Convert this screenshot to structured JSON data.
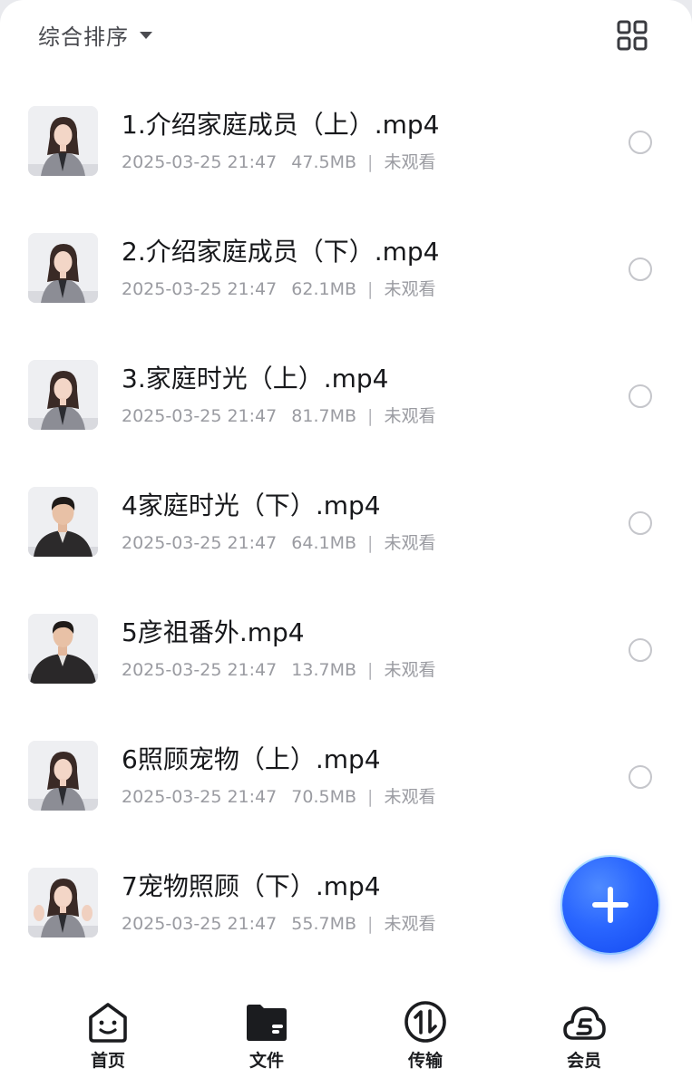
{
  "header": {
    "sort_label": "综合排序",
    "sort_icon": "caret-down-icon",
    "view_toggle_icon": "grid-view-icon"
  },
  "files": [
    {
      "name": "1.介绍家庭成员（上）.mp4",
      "date": "2025-03-25 21:47",
      "size": "47.5MB",
      "status": "未观看",
      "thumb": "woman-presenter"
    },
    {
      "name": "2.介绍家庭成员（下）.mp4",
      "date": "2025-03-25 21:47",
      "size": "62.1MB",
      "status": "未观看",
      "thumb": "woman-presenter"
    },
    {
      "name": "3.家庭时光（上）.mp4",
      "date": "2025-03-25 21:47",
      "size": "81.7MB",
      "status": "未观看",
      "thumb": "woman-presenter"
    },
    {
      "name": "4家庭时光（下）.mp4",
      "date": "2025-03-25 21:47",
      "size": "64.1MB",
      "status": "未观看",
      "thumb": "man-presenter"
    },
    {
      "name": "5彦祖番外.mp4",
      "date": "2025-03-25 21:47",
      "size": "13.7MB",
      "status": "未观看",
      "thumb": "man-presenter"
    },
    {
      "name": "6照顾宠物（上）.mp4",
      "date": "2025-03-25 21:47",
      "size": "70.5MB",
      "status": "未观看",
      "thumb": "woman-presenter"
    },
    {
      "name": "7宠物照顾（下）.mp4",
      "date": "2025-03-25 21:47",
      "size": "55.7MB",
      "status": "未观看",
      "thumb": "woman-presenter"
    }
  ],
  "fab": {
    "icon": "plus-icon",
    "color": "#2a66ff"
  },
  "nav": [
    {
      "label": "首页",
      "icon": "home-smile-icon"
    },
    {
      "label": "文件",
      "icon": "folder-icon",
      "active": true
    },
    {
      "label": "传输",
      "icon": "transfer-icon"
    },
    {
      "label": "会员",
      "icon": "vip-cloud-icon"
    }
  ],
  "colors": {
    "text_primary": "#17181b",
    "text_secondary": "#9a9ba1",
    "accent": "#2a66ff"
  }
}
